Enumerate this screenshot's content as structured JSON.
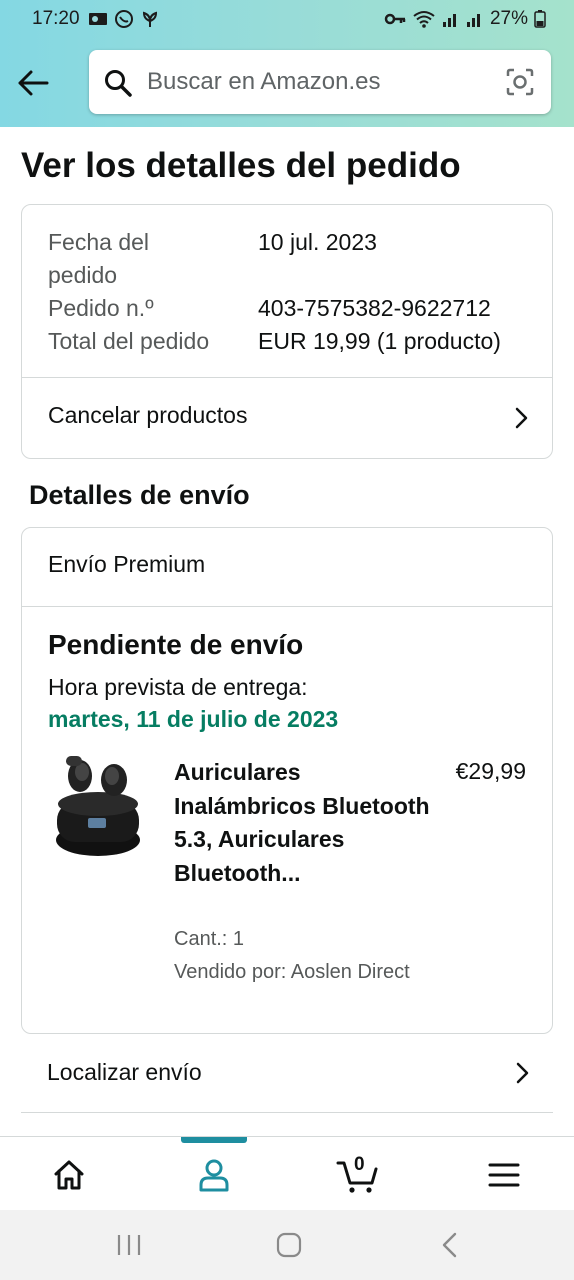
{
  "status_bar": {
    "time": "17:20",
    "battery": "27%"
  },
  "header": {
    "search_placeholder": "Buscar en Amazon.es"
  },
  "page_title": "Ver los detalles del pedido",
  "order_summary": {
    "date_label_line1": "Fecha del",
    "date_label_line2": "pedido",
    "date_value": "10 jul. 2023",
    "number_label": "Pedido n.º",
    "number_value": "403-7575382-9622712",
    "total_label": "Total del pedido",
    "total_value": "EUR 19,99 (1 producto)",
    "cancel_label": "Cancelar productos"
  },
  "shipping": {
    "section_title": "Detalles de envío",
    "type": "Envío Premium",
    "status": "Pendiente de envío",
    "eta_label": "Hora prevista de entrega:",
    "eta_date": "martes, 11 de julio de 2023",
    "product": {
      "title": "Auriculares Inalámbricos Bluetooth 5.3, Auriculares Bluetooth...",
      "price": "€29,99",
      "qty": "Cant.: 1",
      "seller": "Vendido por: Aoslen Direct"
    },
    "track_label": "Localizar envío"
  },
  "bottom_nav": {
    "cart_count": "0",
    "active_color": "#1e8ea0"
  },
  "colors": {
    "eta_green": "#067d62",
    "header_gradient_start": "#84d8e3",
    "header_gradient_end": "#a5e2cc"
  }
}
